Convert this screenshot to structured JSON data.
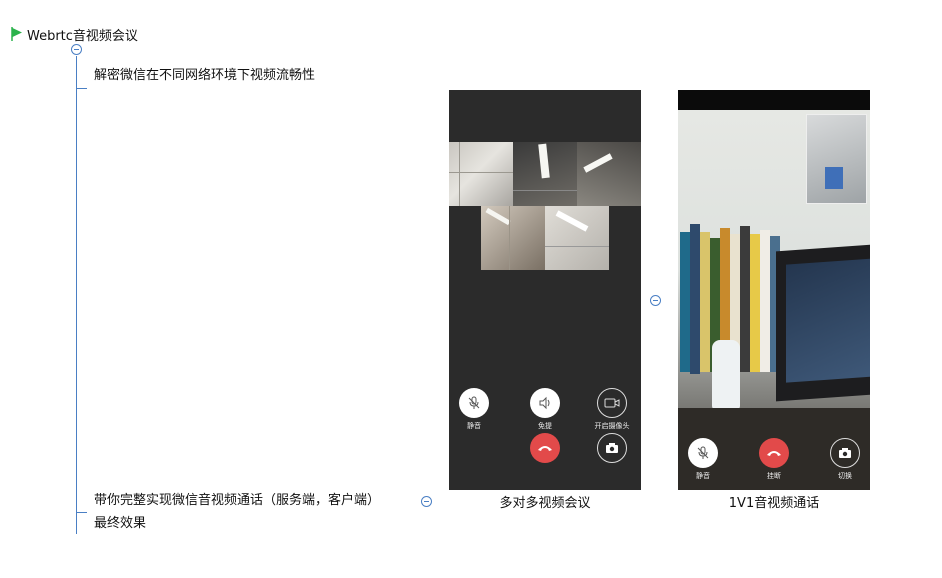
{
  "root": {
    "title": "Webrtc音视频会议",
    "flag_color": "#2bb24c"
  },
  "branches": [
    {
      "text": "解密微信在不同网络环境下视频流畅性"
    },
    {
      "line1": "带你完整实现微信音视频通话（服务端，客户端）",
      "line2": "最终效果"
    }
  ],
  "colors": {
    "connector": "#4a7fc4",
    "phone_bg": "#2b2b2b",
    "hangup": "#e24a4a"
  },
  "multi_call": {
    "caption": "多对多视频会议",
    "controls": {
      "mute": "静音",
      "speaker": "免提",
      "camera": "开启摄像头"
    },
    "icons": [
      "mic-off-icon",
      "speaker-icon",
      "video-camera-icon",
      "hangup-icon",
      "switch-camera-icon"
    ]
  },
  "one_on_one": {
    "caption": "1V1音视频通话",
    "controls": {
      "mute": "静音",
      "hangup": "挂断",
      "switch": "切换"
    },
    "icons": [
      "mic-off-icon",
      "hangup-icon",
      "switch-camera-icon"
    ]
  }
}
